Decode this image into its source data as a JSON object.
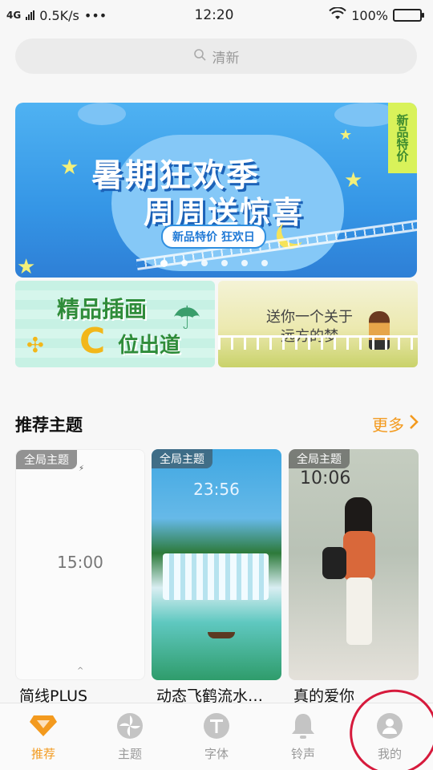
{
  "status_bar": {
    "network": "4G",
    "speed": "0.5K/s",
    "more": "•••",
    "time": "12:20",
    "battery": "100%"
  },
  "search": {
    "placeholder": "清新"
  },
  "banner": {
    "headline_1": "暑期狂欢季",
    "headline_2": "周周送惊喜",
    "pill": "新品特价 狂欢日",
    "ribbon": "新品特价",
    "dots_count": 6,
    "active_dot": 1
  },
  "promos": [
    {
      "title": "精品插画",
      "title2": "位出道",
      "c": "C"
    },
    {
      "line1": "送你一个关于",
      "line2": "远方的梦"
    }
  ],
  "section": {
    "title": "推荐主题",
    "more": "更多"
  },
  "themes": [
    {
      "tag": "全局主题",
      "clock": "15:00",
      "name": "简线PLUS"
    },
    {
      "tag": "全局主题",
      "clock": "23:56",
      "name": "动态飞鹤流水…"
    },
    {
      "tag": "全局主题",
      "clock": "10:06",
      "name": "真的爱你"
    }
  ],
  "nav": [
    {
      "label": "推荐",
      "icon": "diamond-icon",
      "active": true
    },
    {
      "label": "主题",
      "icon": "pinwheel-icon",
      "active": false
    },
    {
      "label": "字体",
      "icon": "font-t-icon",
      "active": false
    },
    {
      "label": "铃声",
      "icon": "bell-icon",
      "active": false
    },
    {
      "label": "我的",
      "icon": "profile-icon",
      "active": false
    }
  ],
  "colors": {
    "accent": "#f39a1e",
    "nav_inactive": "#999999",
    "annotation": "#d61a3c"
  }
}
